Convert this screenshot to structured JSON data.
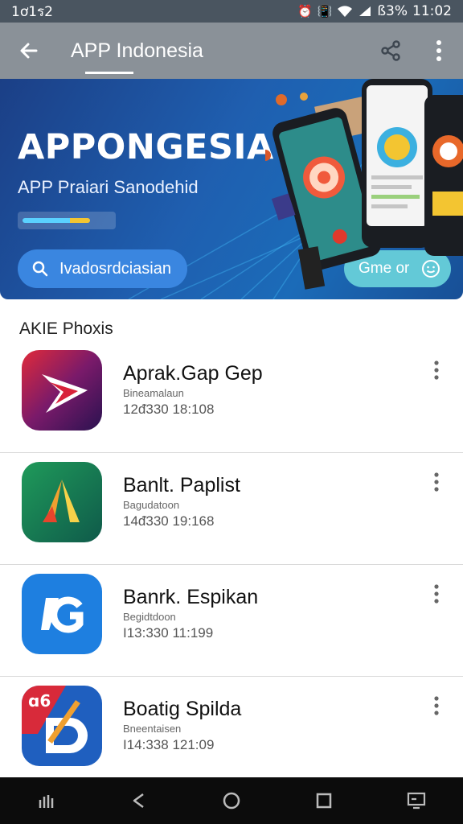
{
  "status_bar": {
    "time_left": "1ơ1ร2",
    "battery": "ß3%",
    "clock": "11:02"
  },
  "app_bar": {
    "title": "APP Indonesia",
    "back_icon": "arrow-left-icon",
    "share_icon": "share-icon",
    "menu_icon": "more-vertical-icon",
    "color": "#8a9198"
  },
  "banner": {
    "title": "APPONGESIA",
    "subtitle": "APP Praiari Sanodehid",
    "progress": 0.76,
    "search_label": "Ivadosrdciasian",
    "cta_label": "Gme or",
    "accent": "#3a86e0"
  },
  "section": {
    "header": "AKIE Phoxis"
  },
  "apps": [
    {
      "name": "Aprak.Gap Gep",
      "subtitle": "Bineamalaun",
      "meta": "12ᵭ330 18:108",
      "icon": "play-arrow-icon"
    },
    {
      "name": "Banlt. Paplist",
      "subtitle": "Bagudatoon",
      "meta": "14ᵭ330 19:168",
      "icon": "a-triangle-icon"
    },
    {
      "name": "Banrk. Espikan",
      "subtitle": "Begidtdoon",
      "meta": "I13:330 11:199",
      "icon": "g-letter-icon"
    },
    {
      "name": "Boatig Spilda",
      "subtitle": "Bneentaisen",
      "meta": "I14:338 121:09",
      "icon": "bd-badge-icon"
    }
  ],
  "nav_bar": {
    "items": [
      "recents-icon",
      "back-icon",
      "home-icon",
      "overview-icon",
      "screenshot-icon"
    ]
  }
}
